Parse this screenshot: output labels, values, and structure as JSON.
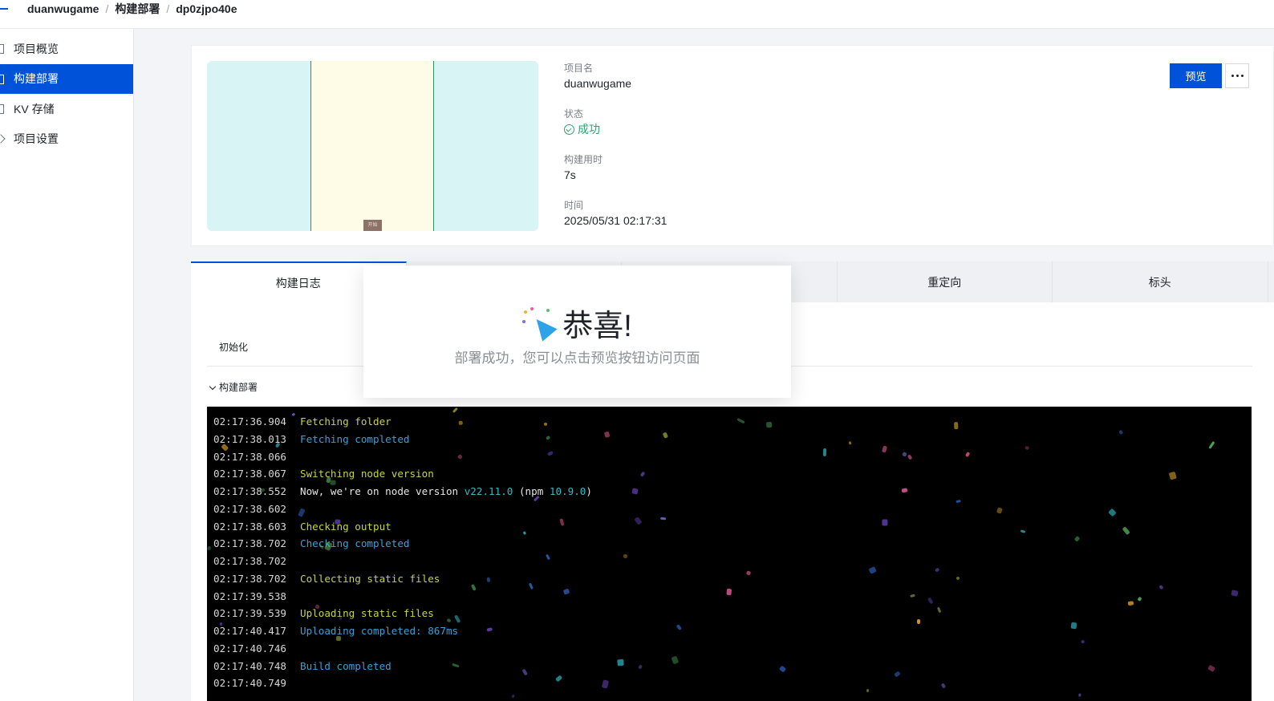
{
  "breadcrumb": {
    "project": "duanwugame",
    "section": "构建部署",
    "deployment": "dp0zjpo40e",
    "separator": "/"
  },
  "sidebar": {
    "items": [
      {
        "label": "项目概览",
        "icon": "overview-icon",
        "active": false
      },
      {
        "label": "构建部署",
        "icon": "deploy-icon",
        "active": true
      },
      {
        "label": "KV 存储",
        "icon": "storage-icon",
        "active": false
      },
      {
        "label": "项目设置",
        "icon": "settings-icon",
        "active": false
      }
    ]
  },
  "project": {
    "name_label": "项目名",
    "name": "duanwugame",
    "status_label": "状态",
    "status": "成功",
    "duration_label": "构建用时",
    "duration": "7s",
    "time_label": "时间",
    "time": "2025/05/31 02:17:31",
    "thumbnail_button": "开始"
  },
  "actions": {
    "preview": "预览",
    "more": "more-icon"
  },
  "tabs": [
    {
      "label": "构建日志",
      "active": true
    },
    {
      "label": "",
      "active": false
    },
    {
      "label": "",
      "active": false
    },
    {
      "label": "重定向",
      "active": false
    },
    {
      "label": "标头",
      "active": false
    }
  ],
  "steps": {
    "init": "初始化",
    "deploy": "构建部署"
  },
  "log": [
    {
      "ts": "02:17:36.904",
      "parts": [
        {
          "text": "Fetching folder",
          "color": "yellow"
        }
      ]
    },
    {
      "ts": "02:17:38.013",
      "parts": [
        {
          "text": "Fetching completed",
          "color": "blue"
        }
      ]
    },
    {
      "ts": "02:17:38.066",
      "parts": []
    },
    {
      "ts": "02:17:38.067",
      "parts": [
        {
          "text": "Switching node version",
          "color": "yellow"
        }
      ]
    },
    {
      "ts": "02:17:38.552",
      "parts": [
        {
          "text": "Now, we're on node version ",
          "color": "white"
        },
        {
          "text": "v22.11.0",
          "color": "cyan"
        },
        {
          "text": " (npm ",
          "color": "white"
        },
        {
          "text": "10.9.0",
          "color": "cyan"
        },
        {
          "text": ")",
          "color": "white"
        }
      ]
    },
    {
      "ts": "02:17:38.602",
      "parts": []
    },
    {
      "ts": "02:17:38.603",
      "parts": [
        {
          "text": "Checking output",
          "color": "yellow"
        }
      ]
    },
    {
      "ts": "02:17:38.702",
      "parts": [
        {
          "text": "Checking completed",
          "color": "blue"
        }
      ]
    },
    {
      "ts": "02:17:38.702",
      "parts": []
    },
    {
      "ts": "02:17:38.702",
      "parts": [
        {
          "text": "Collecting static files",
          "color": "yellow"
        }
      ]
    },
    {
      "ts": "02:17:39.538",
      "parts": []
    },
    {
      "ts": "02:17:39.539",
      "parts": [
        {
          "text": "Uploading static files",
          "color": "yellow"
        }
      ]
    },
    {
      "ts": "02:17:40.417",
      "parts": [
        {
          "text": "Uploading completed: 867ms",
          "color": "blue"
        }
      ]
    },
    {
      "ts": "02:17:40.746",
      "parts": []
    },
    {
      "ts": "02:17:40.748",
      "parts": [
        {
          "text": "Build completed",
          "color": "blue"
        }
      ]
    },
    {
      "ts": "02:17:40.749",
      "parts": []
    }
  ],
  "modal": {
    "icon": "party-popper-icon",
    "title": "恭喜!",
    "message": "部署成功，您可以点击预览按钮访问页面"
  },
  "colors": {
    "primary": "#0052d9",
    "success": "#2ba471",
    "log_yellow": "#c7d24a",
    "log_blue": "#3aa0d8",
    "log_cyan": "#2fbcc6"
  }
}
